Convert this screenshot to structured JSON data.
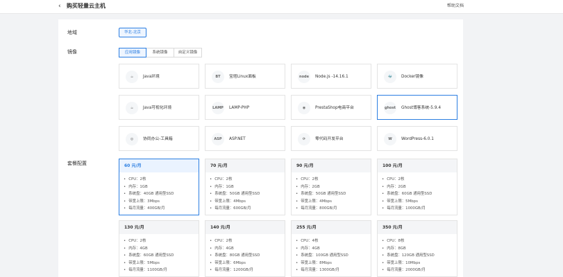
{
  "header": {
    "back_icon": "‹",
    "title": "购买轻量云主机",
    "help": "帮助文档"
  },
  "region": {
    "label": "地域",
    "selected": "华北-北京"
  },
  "image": {
    "label": "镜像",
    "tabs": [
      {
        "label": "应用镜像",
        "active": true
      },
      {
        "label": "系统镜像",
        "active": false
      },
      {
        "label": "自定义镜像",
        "active": false
      }
    ],
    "items": [
      {
        "name": "Java环境",
        "icon": "java-icon",
        "logo": "☕"
      },
      {
        "name": "宝塔Linux面板",
        "icon": "bt-panel-icon",
        "logo": "BT"
      },
      {
        "name": "Node.js -14.16.1",
        "icon": "nodejs-icon",
        "logo": "node"
      },
      {
        "name": "Docker镜像",
        "icon": "docker-icon",
        "logo": "🐳"
      },
      {
        "name": "Java可视化环境",
        "icon": "java-icon",
        "logo": "☕"
      },
      {
        "name": "LAMP-PHP",
        "icon": "lamp-icon",
        "logo": "LAMP"
      },
      {
        "name": "PrestaShop电商平台",
        "icon": "prestashop-icon",
        "logo": "◉"
      },
      {
        "name": "Ghost博客系统-5.9.4",
        "icon": "ghost-icon",
        "logo": "ghost",
        "selected": true
      },
      {
        "name": "协同办公-工具箱",
        "icon": "office-tools-icon",
        "logo": "◎"
      },
      {
        "name": "ASP.NET",
        "icon": "aspnet-icon",
        "logo": "ASP"
      },
      {
        "name": "零代码开发平台",
        "icon": "lowcode-icon",
        "logo": "⟳"
      },
      {
        "name": "WordPress-6.0.1",
        "icon": "wordpress-icon",
        "logo": "W"
      }
    ]
  },
  "plans": {
    "label": "套餐配置",
    "items": [
      {
        "price": "60 元/月",
        "selected": true,
        "specs": [
          "CPU：2核",
          "内存：1GB",
          "系统盘：40GB 通用型SSD",
          "带宽上限：3Mbps",
          "每月流量：400GB/月"
        ]
      },
      {
        "price": "70 元/月",
        "specs": [
          "CPU：2核",
          "内存：1GB",
          "系统盘：50GB 通用型SSD",
          "带宽上限：4Mbps",
          "每月流量：600GB/月"
        ]
      },
      {
        "price": "90 元/月",
        "specs": [
          "CPU：2核",
          "内存：2GB",
          "系统盘：50GB 通用型SSD",
          "带宽上限：4Mbps",
          "每月流量：800GB/月"
        ]
      },
      {
        "price": "100 元/月",
        "specs": [
          "CPU：2核",
          "内存：2GB",
          "系统盘：60GB 通用型SSD",
          "带宽上限：5Mbps",
          "每月流量：1000GB/月"
        ]
      },
      {
        "price": "130 元/月",
        "specs": [
          "CPU：2核",
          "内存：4GB",
          "系统盘：60GB 通用型SSD",
          "带宽上限：5Mbps",
          "每月流量：1100GB/月"
        ]
      },
      {
        "price": "140 元/月",
        "specs": [
          "CPU：2核",
          "内存：4GB",
          "系统盘：80GB 通用型SSD",
          "带宽上限：6Mbps",
          "每月流量：1200GB/月"
        ]
      },
      {
        "price": "255 元/月",
        "specs": [
          "CPU：4核",
          "内存：4GB",
          "系统盘：100GB 通用型SSD",
          "带宽上限：8Mbps",
          "每月流量：1300GB/月"
        ]
      },
      {
        "price": "350 元/月",
        "specs": [
          "CPU：8核",
          "内存：8GB",
          "系统盘：120GB 通用型SSD",
          "带宽上限：10Mbps",
          "每月流量：2000GB/月"
        ]
      }
    ]
  }
}
